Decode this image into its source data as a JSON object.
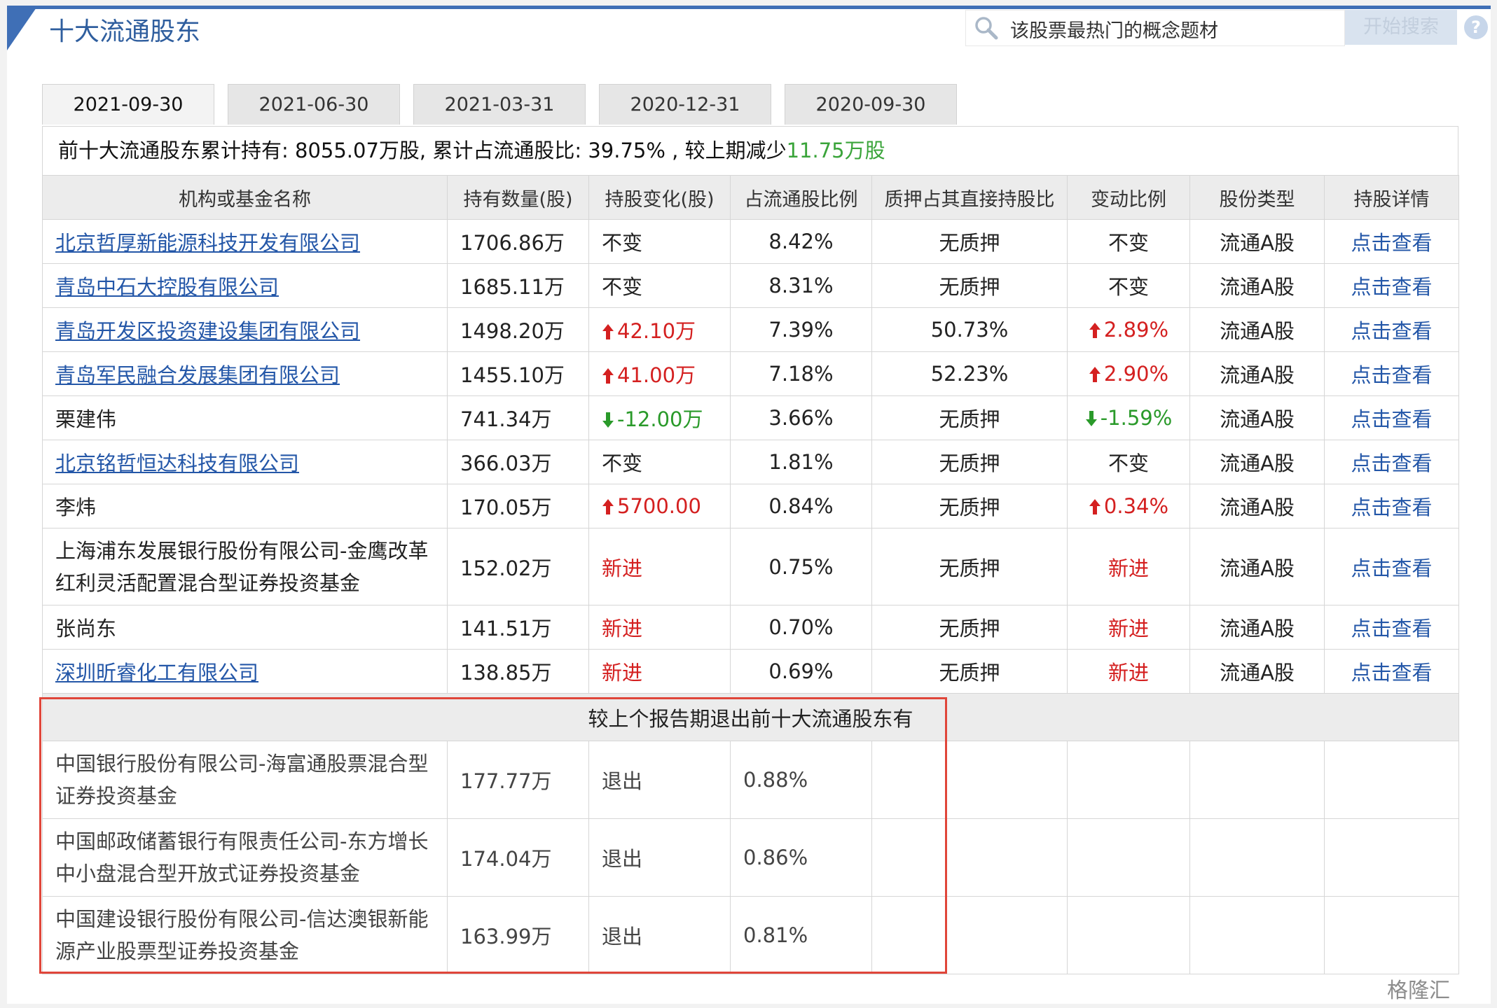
{
  "section": {
    "title": "十大流通股东"
  },
  "search": {
    "placeholder": "该股票最热门的概念题材",
    "button_label": "开始搜索"
  },
  "tabs": [
    {
      "label": "2021-09-30",
      "active": true
    },
    {
      "label": "2021-06-30",
      "active": false
    },
    {
      "label": "2021-03-31",
      "active": false
    },
    {
      "label": "2020-12-31",
      "active": false
    },
    {
      "label": "2020-09-30",
      "active": false
    }
  ],
  "summary": {
    "text": "前十大流通股东累计持有: 8055.07万股, 累计占流通股比: 39.75% , 较上期减少",
    "change": "11.75万股"
  },
  "table": {
    "headers": [
      "机构或基金名称",
      "持有数量(股)",
      "持股变化(股)",
      "占流通股比例",
      "质押占其直接持股比",
      "变动比例",
      "股份类型",
      "持股详情"
    ],
    "rows": [
      {
        "name": "北京哲厚新能源科技开发有限公司",
        "link": true,
        "amount": "1706.86万",
        "change": "不变",
        "change_dir": "none",
        "ratio": "8.42%",
        "pledge": "无质押",
        "change_ratio": "不变",
        "ratio_dir": "none",
        "type": "流通A股",
        "detail": "点击查看"
      },
      {
        "name": "青岛中石大控股有限公司",
        "link": true,
        "amount": "1685.11万",
        "change": "不变",
        "change_dir": "none",
        "ratio": "8.31%",
        "pledge": "无质押",
        "change_ratio": "不变",
        "ratio_dir": "none",
        "type": "流通A股",
        "detail": "点击查看"
      },
      {
        "name": "青岛开发区投资建设集团有限公司",
        "link": true,
        "amount": "1498.20万",
        "change": "42.10万",
        "change_dir": "up",
        "ratio": "7.39%",
        "pledge": "50.73%",
        "change_ratio": "2.89%",
        "ratio_dir": "up",
        "type": "流通A股",
        "detail": "点击查看"
      },
      {
        "name": "青岛军民融合发展集团有限公司",
        "link": true,
        "amount": "1455.10万",
        "change": "41.00万",
        "change_dir": "up",
        "ratio": "7.18%",
        "pledge": "52.23%",
        "change_ratio": "2.90%",
        "ratio_dir": "up",
        "type": "流通A股",
        "detail": "点击查看"
      },
      {
        "name": "栗建伟",
        "link": false,
        "amount": "741.34万",
        "change": "-12.00万",
        "change_dir": "down",
        "ratio": "3.66%",
        "pledge": "无质押",
        "change_ratio": "-1.59%",
        "ratio_dir": "down",
        "type": "流通A股",
        "detail": "点击查看"
      },
      {
        "name": "北京铭哲恒达科技有限公司",
        "link": true,
        "amount": "366.03万",
        "change": "不变",
        "change_dir": "none",
        "ratio": "1.81%",
        "pledge": "无质押",
        "change_ratio": "不变",
        "ratio_dir": "none",
        "type": "流通A股",
        "detail": "点击查看"
      },
      {
        "name": "李炜",
        "link": false,
        "amount": "170.05万",
        "change": "5700.00",
        "change_dir": "up",
        "ratio": "0.84%",
        "pledge": "无质押",
        "change_ratio": "0.34%",
        "ratio_dir": "up",
        "type": "流通A股",
        "detail": "点击查看"
      },
      {
        "name": "上海浦东发展银行股份有限公司-金鹰改革红利灵活配置混合型证券投资基金",
        "link": false,
        "wrap": true,
        "amount": "152.02万",
        "change": "新进",
        "change_dir": "new",
        "ratio": "0.75%",
        "pledge": "无质押",
        "change_ratio": "新进",
        "ratio_dir": "new",
        "type": "流通A股",
        "detail": "点击查看"
      },
      {
        "name": "张尚东",
        "link": false,
        "amount": "141.51万",
        "change": "新进",
        "change_dir": "new",
        "ratio": "0.70%",
        "pledge": "无质押",
        "change_ratio": "新进",
        "ratio_dir": "new",
        "type": "流通A股",
        "detail": "点击查看"
      },
      {
        "name": "深圳昕睿化工有限公司",
        "link": true,
        "amount": "138.85万",
        "change": "新进",
        "change_dir": "new",
        "ratio": "0.69%",
        "pledge": "无质押",
        "change_ratio": "新进",
        "ratio_dir": "new",
        "type": "流通A股",
        "detail": "点击查看"
      }
    ]
  },
  "exited": {
    "title": "较上个报告期退出前十大流通股东有",
    "rows": [
      {
        "name": "中国银行股份有限公司-海富通股票混合型证券投资基金",
        "amount": "177.77万",
        "change": "退出",
        "ratio": "0.88%"
      },
      {
        "name": "中国邮政储蓄银行有限责任公司-东方增长中小盘混合型开放式证券投资基金",
        "amount": "174.04万",
        "change": "退出",
        "ratio": "0.86%"
      },
      {
        "name": "中国建设银行股份有限公司-信达澳银新能源产业股票型证券投资基金",
        "amount": "163.99万",
        "change": "退出",
        "ratio": "0.81%"
      }
    ]
  },
  "watermark": {
    "text": "格隆汇"
  },
  "colors": {
    "accent": "#3f6fb6",
    "link": "#2457a8",
    "up": "#d42020",
    "down": "#2a9a2a",
    "highlight_box": "#e0463a"
  }
}
